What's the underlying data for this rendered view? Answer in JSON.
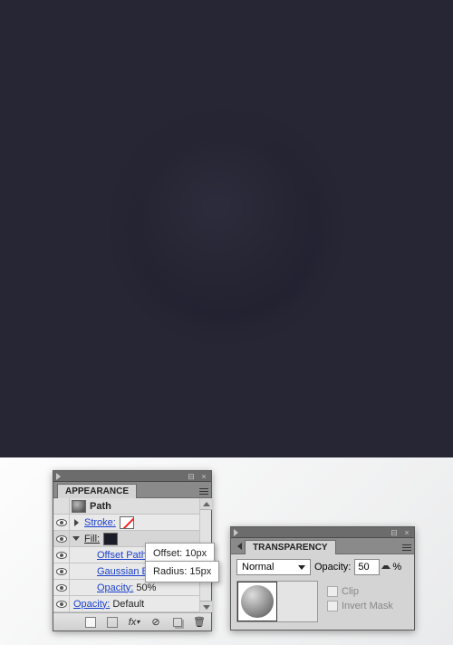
{
  "canvas": {
    "bg": "#262634"
  },
  "appearance": {
    "title": "APPEARANCE",
    "path_label": "Path",
    "stroke_label": "Stroke:",
    "fill_label": "Fill:",
    "effects": {
      "offset_path": "Offset Path",
      "gaussian_blur": "Gaussian Blur",
      "opacity_label": "Opacity:",
      "opacity_value": "50%"
    },
    "bottom_opacity_label": "Opacity:",
    "bottom_opacity_value": "Default",
    "tooltip_offset": "Offset: 10px",
    "tooltip_radius": "Radius: 15px",
    "footer_fx": "fx"
  },
  "transparency": {
    "title": "TRANSPARENCY",
    "blend_mode": "Normal",
    "opacity_label": "Opacity:",
    "opacity_value": "50",
    "opacity_unit": "%",
    "clip_label": "Clip",
    "invert_label": "Invert Mask"
  }
}
